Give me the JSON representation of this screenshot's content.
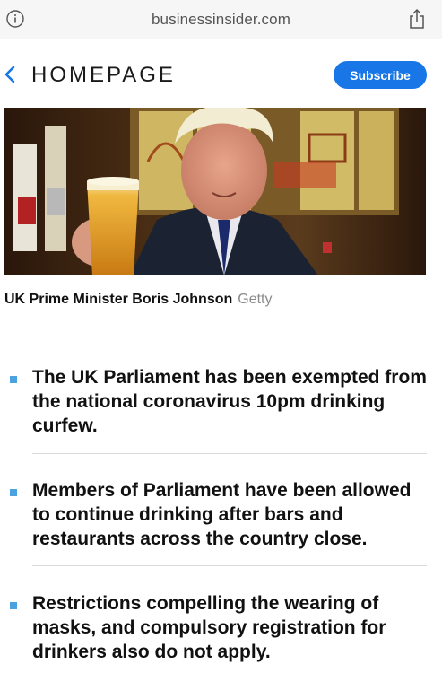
{
  "browser": {
    "url": "businessinsider.com",
    "icons": {
      "info": "info-icon",
      "share": "share-icon"
    }
  },
  "nav": {
    "back_icon": "chevron-left-icon",
    "title": "HOMEPAGE",
    "subscribe_label": "Subscribe"
  },
  "hero": {
    "caption": "UK Prime Minister Boris Johnson",
    "credit": "Getty"
  },
  "bullets": [
    {
      "text": "The UK Parliament has been exempted from the national coronavirus 10pm drinking curfew."
    },
    {
      "text": "Members of Parliament have been allowed to continue drinking after bars and restaurants across the country close."
    },
    {
      "text": "Restrictions compelling the wearing of masks, and compulsory registration for drinkers also do not apply."
    }
  ],
  "colors": {
    "accent": "#1876e6",
    "bullet": "#4aa3df"
  }
}
